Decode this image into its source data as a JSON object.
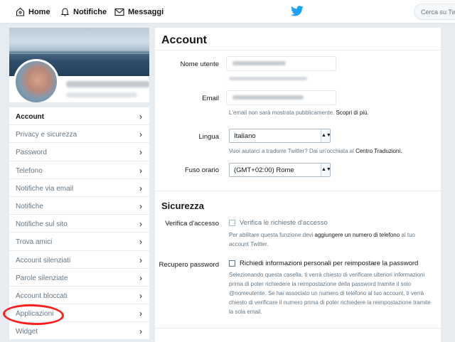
{
  "topbar": {
    "home_label": "Home",
    "notifications_label": "Notifiche",
    "messages_label": "Messaggi",
    "search_placeholder": "Cerca su Twitter",
    "brand_color": "#1da1f2"
  },
  "sidebar": {
    "items": [
      {
        "label": "Account",
        "active": true
      },
      {
        "label": "Privacy e sicurezza"
      },
      {
        "label": "Password"
      },
      {
        "label": "Telefono"
      },
      {
        "label": "Notifiche via email"
      },
      {
        "label": "Notifiche"
      },
      {
        "label": "Notifiche sul sito"
      },
      {
        "label": "Trova amici"
      },
      {
        "label": "Account silenziati"
      },
      {
        "label": "Parole silenziate"
      },
      {
        "label": "Account bloccati"
      },
      {
        "label": "Applicazioni",
        "highlighted": true
      },
      {
        "label": "Widget"
      }
    ],
    "chevron": "›",
    "highlight_color": "#ff1e1e"
  },
  "account": {
    "title": "Account",
    "username_label": "Nome utente",
    "email_label": "Email",
    "email_help": "L'email non sarà mostrata pubblicamente.",
    "email_help_link": "Scopri di più.",
    "language_label": "Lingua",
    "language_value": "Italiano",
    "language_help": "Vuoi aiutarci a tradurre Twitter? Dai un'occhiata al",
    "language_help_link": "Centro Traduzioni.",
    "timezone_label": "Fuso orario",
    "timezone_value": "(GMT+02:00) Rome"
  },
  "security": {
    "title": "Sicurezza",
    "login_verification_label": "Verifica d'accesso",
    "login_verification_checkbox": "Verifica le richieste d'accesso",
    "login_verification_help_1": "Per abilitare questa funzione devi",
    "login_verification_help_link": "aggiungere un numero di telefono",
    "login_verification_help_2": "al tuo account Twitter.",
    "password_reset_label": "Recupero password",
    "password_reset_checkbox": "Richiedi informazioni personali per reimpostare la password",
    "password_reset_help": "Selezionando questa casella, ti verrà chiesto di verificare ulteriori informazioni prima di poter richiedere la reimpostazione della password tramite il solo @nomeutente. Se hai associato un numero di telefono al tuo account, ti verrà chiesto di verificare il numero prima di poter richiedere la reimpostazione tramite la sola email."
  }
}
